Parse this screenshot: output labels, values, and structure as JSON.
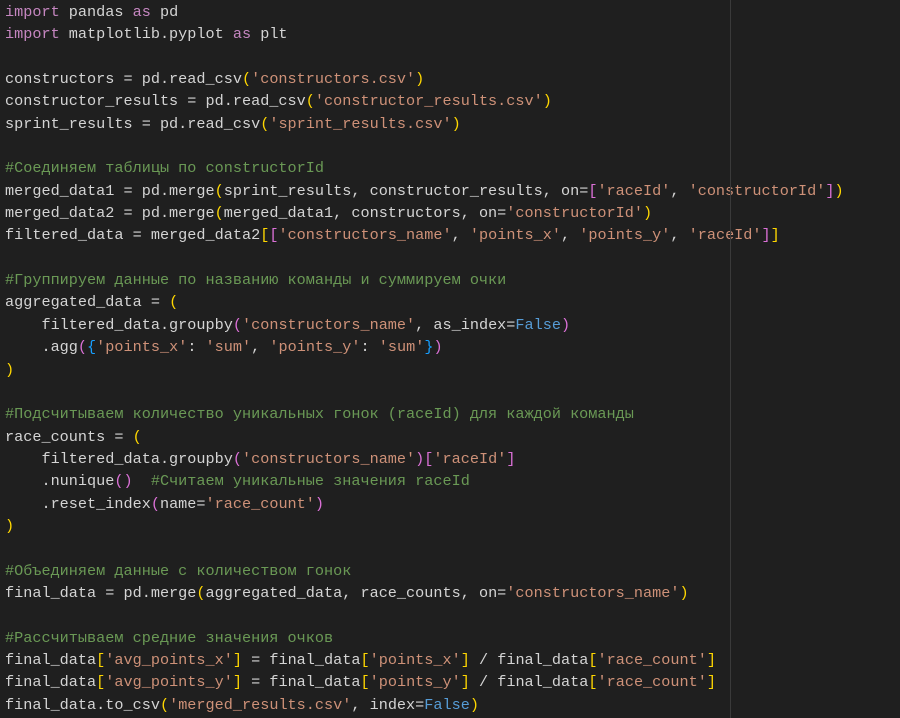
{
  "editor": {
    "lines": [
      [
        [
          "k",
          "import"
        ],
        [
          "t",
          " pandas "
        ],
        [
          "k",
          "as"
        ],
        [
          "t",
          " pd"
        ]
      ],
      [
        [
          "k",
          "import"
        ],
        [
          "t",
          " matplotlib.pyplot "
        ],
        [
          "k",
          "as"
        ],
        [
          "t",
          " plt"
        ]
      ],
      [],
      [
        [
          "t",
          "constructors = pd.read_csv"
        ],
        [
          "b1",
          "("
        ],
        [
          "s",
          "'constructors.csv'"
        ],
        [
          "b1",
          ")"
        ]
      ],
      [
        [
          "t",
          "constructor_results = pd.read_csv"
        ],
        [
          "b1",
          "("
        ],
        [
          "s",
          "'constructor_results.csv'"
        ],
        [
          "b1",
          ")"
        ]
      ],
      [
        [
          "t",
          "sprint_results = pd.read_csv"
        ],
        [
          "b1",
          "("
        ],
        [
          "s",
          "'sprint_results.csv'"
        ],
        [
          "b1",
          ")"
        ]
      ],
      [],
      [
        [
          "c",
          "#Соединяем таблицы по constructorId"
        ]
      ],
      [
        [
          "t",
          "merged_data1 = pd.merge"
        ],
        [
          "b1",
          "("
        ],
        [
          "t",
          "sprint_results, constructor_results, on="
        ],
        [
          "b2",
          "["
        ],
        [
          "s",
          "'raceId'"
        ],
        [
          "t",
          ", "
        ],
        [
          "s",
          "'constructorId'"
        ],
        [
          "b2",
          "]"
        ],
        [
          "b1",
          ")"
        ]
      ],
      [
        [
          "t",
          "merged_data2 = pd.merge"
        ],
        [
          "b1",
          "("
        ],
        [
          "t",
          "merged_data1, constructors, on="
        ],
        [
          "s",
          "'constructorId'"
        ],
        [
          "b1",
          ")"
        ]
      ],
      [
        [
          "t",
          "filtered_data = merged_data2"
        ],
        [
          "b1",
          "["
        ],
        [
          "b2",
          "["
        ],
        [
          "s",
          "'constructors_name'"
        ],
        [
          "t",
          ", "
        ],
        [
          "s",
          "'points_x'"
        ],
        [
          "t",
          ", "
        ],
        [
          "s",
          "'points_y'"
        ],
        [
          "t",
          ", "
        ],
        [
          "s",
          "'raceId'"
        ],
        [
          "b2",
          "]"
        ],
        [
          "b1",
          "]"
        ]
      ],
      [],
      [
        [
          "c",
          "#Группируем данные по названию команды и суммируем очки"
        ]
      ],
      [
        [
          "t",
          "aggregated_data = "
        ],
        [
          "b1",
          "("
        ]
      ],
      [
        [
          "t",
          "    filtered_data.groupby"
        ],
        [
          "b2",
          "("
        ],
        [
          "s",
          "'constructors_name'"
        ],
        [
          "t",
          ", as_index="
        ],
        [
          "f",
          "False"
        ],
        [
          "b2",
          ")"
        ]
      ],
      [
        [
          "t",
          "    .agg"
        ],
        [
          "b2",
          "("
        ],
        [
          "b3",
          "{"
        ],
        [
          "s",
          "'points_x'"
        ],
        [
          "t",
          ": "
        ],
        [
          "s",
          "'sum'"
        ],
        [
          "t",
          ", "
        ],
        [
          "s",
          "'points_y'"
        ],
        [
          "t",
          ": "
        ],
        [
          "s",
          "'sum'"
        ],
        [
          "b3",
          "}"
        ],
        [
          "b2",
          ")"
        ]
      ],
      [
        [
          "b1",
          ")"
        ]
      ],
      [],
      [
        [
          "c",
          "#Подсчитываем количество уникальных гонок (raceId) для каждой команды"
        ]
      ],
      [
        [
          "t",
          "race_counts = "
        ],
        [
          "b1",
          "("
        ]
      ],
      [
        [
          "t",
          "    filtered_data.groupby"
        ],
        [
          "b2",
          "("
        ],
        [
          "s",
          "'constructors_name'"
        ],
        [
          "b2",
          ")"
        ],
        [
          "b2",
          "["
        ],
        [
          "s",
          "'raceId'"
        ],
        [
          "b2",
          "]"
        ]
      ],
      [
        [
          "t",
          "    .nunique"
        ],
        [
          "b2",
          "()"
        ],
        [
          "t",
          "  "
        ],
        [
          "c",
          "#Считаем уникальные значения raceId"
        ]
      ],
      [
        [
          "t",
          "    .reset_index"
        ],
        [
          "b2",
          "("
        ],
        [
          "t",
          "name="
        ],
        [
          "s",
          "'race_count'"
        ],
        [
          "b2",
          ")"
        ]
      ],
      [
        [
          "b1",
          ")"
        ]
      ],
      [],
      [
        [
          "c",
          "#Объединяем данные с количеством гонок"
        ]
      ],
      [
        [
          "t",
          "final_data = pd.merge"
        ],
        [
          "b1",
          "("
        ],
        [
          "t",
          "aggregated_data, race_counts, on="
        ],
        [
          "s",
          "'constructors_name'"
        ],
        [
          "b1",
          ")"
        ]
      ],
      [],
      [
        [
          "c",
          "#Рассчитываем средние значения очков"
        ]
      ],
      [
        [
          "t",
          "final_data"
        ],
        [
          "b1",
          "["
        ],
        [
          "s",
          "'avg_points_x'"
        ],
        [
          "b1",
          "]"
        ],
        [
          "t",
          " = final_data"
        ],
        [
          "b1",
          "["
        ],
        [
          "s",
          "'points_x'"
        ],
        [
          "b1",
          "]"
        ],
        [
          "t",
          " / final_data"
        ],
        [
          "b1",
          "["
        ],
        [
          "s",
          "'race_count'"
        ],
        [
          "b1",
          "]"
        ]
      ],
      [
        [
          "t",
          "final_data"
        ],
        [
          "b1",
          "["
        ],
        [
          "s",
          "'avg_points_y'"
        ],
        [
          "b1",
          "]"
        ],
        [
          "t",
          " = final_data"
        ],
        [
          "b1",
          "["
        ],
        [
          "s",
          "'points_y'"
        ],
        [
          "b1",
          "]"
        ],
        [
          "t",
          " / final_data"
        ],
        [
          "b1",
          "["
        ],
        [
          "s",
          "'race_count'"
        ],
        [
          "b1",
          "]"
        ]
      ],
      [
        [
          "t",
          "final_data.to_csv"
        ],
        [
          "b1",
          "("
        ],
        [
          "s",
          "'merged_results.csv'"
        ],
        [
          "t",
          ", index="
        ],
        [
          "f",
          "False"
        ],
        [
          "b1",
          ")"
        ]
      ]
    ]
  }
}
